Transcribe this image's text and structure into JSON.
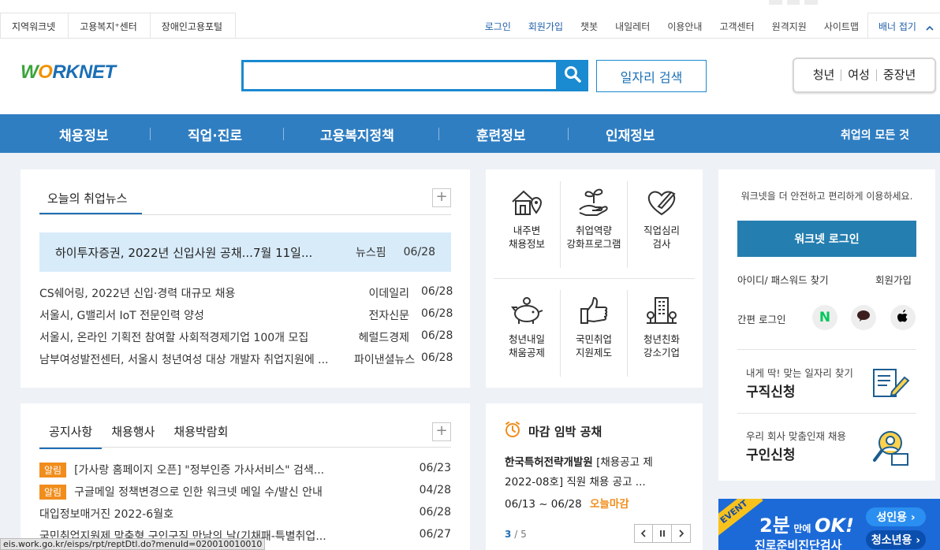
{
  "family_sites": [
    "지역워크넷",
    "고용복지⁺센터",
    "장애인고용포털"
  ],
  "util_links": [
    {
      "label": "로그인",
      "highlight": true
    },
    {
      "label": "회원가입",
      "highlight": true
    },
    {
      "label": "챗봇",
      "highlight": false
    },
    {
      "label": "내일레터",
      "highlight": false
    },
    {
      "label": "이용안내",
      "highlight": false
    },
    {
      "label": "고객센터",
      "highlight": false
    },
    {
      "label": "원격지원",
      "highlight": false
    },
    {
      "label": "사이트맵",
      "highlight": false
    }
  ],
  "banner_toggle": "배너 접기",
  "logo": {
    "w": "W",
    "o": "O",
    "rest": "RKNET"
  },
  "search": {
    "value": "",
    "placeholder": "",
    "job_search_label": "일자리 검색"
  },
  "segments": [
    "청년",
    "여성",
    "중장년"
  ],
  "gnb": [
    "채용정보",
    "직업·진로",
    "고용복지정책",
    "훈련정보",
    "인재정보"
  ],
  "gnb_all": "취업의 모든 것",
  "news": {
    "title": "오늘의 취업뉴스",
    "headline": {
      "title": "하이투자증권, 2022년 신입사원 공채...7월 11일...",
      "source": "뉴스핌",
      "date": "06/28"
    },
    "items": [
      {
        "title": "CS쉐어링, 2022년 신입·경력 대규모 채용",
        "source": "이데일리",
        "date": "06/28"
      },
      {
        "title": "서울시, G밸리서 IoT 전문인력 양성",
        "source": "전자신문",
        "date": "06/28"
      },
      {
        "title": "서울시, 온라인 기획전 참여할 사회적경제기업 100개 모집",
        "source": "헤럴드경제",
        "date": "06/28"
      },
      {
        "title": "남부여성발전센터, 서울시 청년여성 대상 개발자 취업지원에 ...",
        "source": "파이낸셜뉴스",
        "date": "06/28"
      }
    ]
  },
  "services": [
    {
      "line1": "내주변",
      "line2": "채용정보",
      "icon": "house-location-icon"
    },
    {
      "line1": "취업역량",
      "line2": "강화프로그램",
      "icon": "hand-sprout-icon"
    },
    {
      "line1": "직업심리",
      "line2": "검사",
      "icon": "heart-pen-icon"
    },
    {
      "line1": "청년내일",
      "line2": "채움공제",
      "icon": "piggy-bank-icon"
    },
    {
      "line1": "국민취업",
      "line2": "지원제도",
      "icon": "thumbs-up-icon"
    },
    {
      "line1": "청년친화",
      "line2": "강소기업",
      "icon": "building-icon"
    }
  ],
  "notice": {
    "tabs": [
      "공지사항",
      "채용행사",
      "채용박람회"
    ],
    "items": [
      {
        "badge": "알림",
        "title": "[가사랑 홈페이지 오픈] \"정부인증 가사서비스\" 검색...",
        "date": "06/23"
      },
      {
        "badge": "알림",
        "title": "구글메일 정책변경으로 인한 워크넷 메일 수/발신 안내",
        "date": "04/28"
      },
      {
        "badge": "",
        "title": "대입정보매거진 2022-6월호",
        "date": "06/28"
      },
      {
        "badge": "",
        "title": "국민취업지원제 맞춤형 구인구직 만남의 날(기채패-특별취업...",
        "date": "06/27"
      }
    ]
  },
  "deadline": {
    "title": "마감 임박 공채",
    "company": "한국특허전략개발원",
    "post_line1": "[채용공고 제",
    "post_line2": "2022-08호] 직원 채용 공고 ...",
    "period": "06/13 ~ 06/28",
    "tag": "오늘마감",
    "page_current": "3",
    "page_sep": "/",
    "page_total": "5"
  },
  "login": {
    "guide": "워크넷을 더 안전하고 편리하게 이용하세요.",
    "button": "워크넷 로그인",
    "find": "아이디/ 패스워드 찾기",
    "join": "회원가입",
    "simple": "간편 로그인",
    "sns": [
      {
        "label": "N",
        "color": "#03c75a",
        "icon": "naver-icon"
      },
      {
        "label": "",
        "color": "#3c1e1e",
        "icon": "kakao-icon"
      },
      {
        "label": "",
        "color": "#000000",
        "icon": "apple-icon"
      }
    ]
  },
  "jobseek": {
    "sub": "내게 딱! 맞는 일자리 찾기",
    "title": "구직신청"
  },
  "recruit": {
    "sub": "우리 회사 맞춤인재 채용",
    "title": "구인신청"
  },
  "event": {
    "tag": "EVENT",
    "main": "2분",
    "mid": "만에",
    "ok": "OK!",
    "sub": "진로준비진단검사",
    "adult": "성인용 ›",
    "youth": "청소년용 ›"
  },
  "status_url": "eis.work.go.kr/eisps/rpt/reptDtl.do?menuId=020010010010",
  "colors": {
    "gnb": "#2f7ec2",
    "accent": "#1a8ad1",
    "badge": "#f18d1c",
    "login": "#247eb0"
  }
}
